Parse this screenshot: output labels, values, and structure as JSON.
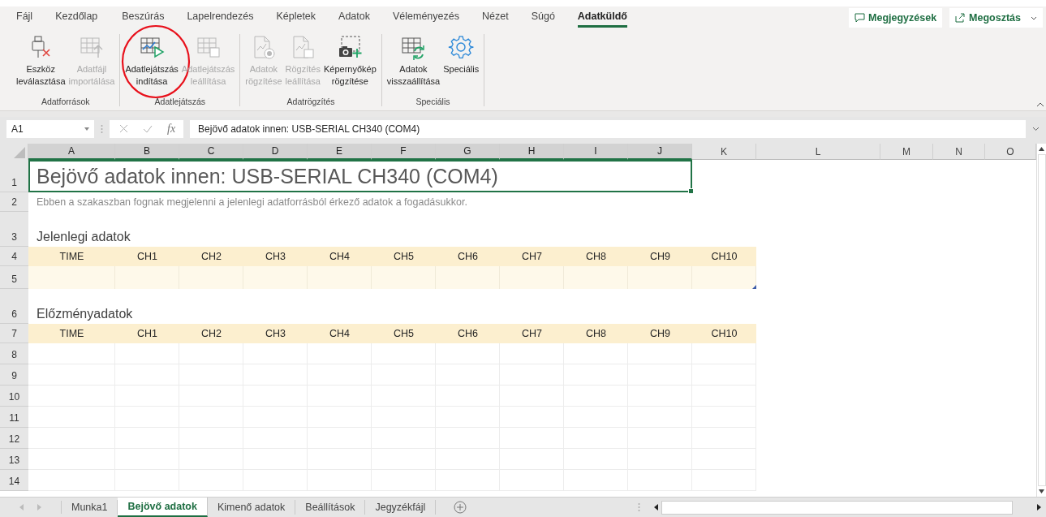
{
  "menu_tabs": [
    {
      "label": "Fájl",
      "selected": false
    },
    {
      "label": "Kezdőlap",
      "selected": false
    },
    {
      "label": "Beszúrás",
      "selected": false
    },
    {
      "label": "Lapelrendezés",
      "selected": false
    },
    {
      "label": "Képletek",
      "selected": false
    },
    {
      "label": "Adatok",
      "selected": false
    },
    {
      "label": "Véleményezés",
      "selected": false
    },
    {
      "label": "Nézet",
      "selected": false
    },
    {
      "label": "Súgó",
      "selected": false
    },
    {
      "label": "Adatküldő",
      "selected": true
    }
  ],
  "top_buttons": [
    {
      "label": "Megjegyzések"
    },
    {
      "label": "Megosztás"
    }
  ],
  "ribbon_groups": [
    {
      "label": "Adatforrások",
      "buttons": [
        {
          "lines": [
            "Eszköz",
            "leválasztása"
          ],
          "disabled": false,
          "circled": false
        },
        {
          "lines": [
            "Adatfájl",
            "importálása"
          ],
          "disabled": true,
          "circled": false
        }
      ]
    },
    {
      "label": "Adatlejátszás",
      "buttons": [
        {
          "lines": [
            "Adatlejátszás",
            "indítása"
          ],
          "disabled": false,
          "circled": true
        },
        {
          "lines": [
            "Adatlejátszás",
            "leállítása"
          ],
          "disabled": true,
          "circled": false
        }
      ]
    },
    {
      "label": "Adatrögzítés",
      "buttons": [
        {
          "lines": [
            "Adatok",
            "rögzítése"
          ],
          "disabled": true,
          "circled": false
        },
        {
          "lines": [
            "Rögzítés",
            "leállítása"
          ],
          "disabled": true,
          "circled": false
        },
        {
          "lines": [
            "Képernyőkép",
            "rögzítése"
          ],
          "disabled": false,
          "circled": false
        }
      ]
    },
    {
      "label": "Speciális",
      "buttons": [
        {
          "lines": [
            "Adatok",
            "visszaállítása"
          ],
          "disabled": false,
          "circled": false
        },
        {
          "lines": [
            "Speciális"
          ],
          "disabled": false,
          "circled": false
        }
      ]
    }
  ],
  "formula_bar": {
    "name_box": "A1",
    "fx_label": "fx",
    "formula": "Bejövő adatok innen: USB-SERIAL CH340 (COM4)"
  },
  "columns": [
    {
      "letter": "A",
      "selected": true
    },
    {
      "letter": "B",
      "selected": true
    },
    {
      "letter": "C",
      "selected": true
    },
    {
      "letter": "D",
      "selected": true
    },
    {
      "letter": "E",
      "selected": true
    },
    {
      "letter": "F",
      "selected": true
    },
    {
      "letter": "G",
      "selected": true
    },
    {
      "letter": "H",
      "selected": true
    },
    {
      "letter": "I",
      "selected": true
    },
    {
      "letter": "J",
      "selected": true
    },
    {
      "letter": "K",
      "selected": false
    },
    {
      "letter": "L",
      "selected": false
    },
    {
      "letter": "M",
      "selected": false
    },
    {
      "letter": "N",
      "selected": false
    },
    {
      "letter": "O",
      "selected": false
    }
  ],
  "rows": [
    {
      "number": "1",
      "kind": "title",
      "text": "Bejövő adatok innen: USB-SERIAL CH340 (COM4)"
    },
    {
      "number": "2",
      "kind": "note",
      "text": "Ebben a szakaszban fognak megjelenni a jelenlegi adatforrásból érkező adatok a fogadásukkor."
    },
    {
      "number": "3",
      "kind": "section",
      "text": "Jelenlegi adatok"
    },
    {
      "number": "4",
      "kind": "header",
      "cells": [
        "TIME",
        "CH1",
        "CH2",
        "CH3",
        "CH4",
        "CH5",
        "CH6",
        "CH7",
        "CH8",
        "CH9",
        "CH10"
      ]
    },
    {
      "number": "5",
      "kind": "data"
    },
    {
      "number": "6",
      "kind": "section",
      "text": "Előzményadatok"
    },
    {
      "number": "7",
      "kind": "header",
      "cells": [
        "TIME",
        "CH1",
        "CH2",
        "CH3",
        "CH4",
        "CH5",
        "CH6",
        "CH7",
        "CH8",
        "CH9",
        "CH10"
      ]
    },
    {
      "number": "8",
      "kind": "empty"
    },
    {
      "number": "9",
      "kind": "empty"
    },
    {
      "number": "10",
      "kind": "empty"
    },
    {
      "number": "11",
      "kind": "empty"
    },
    {
      "number": "12",
      "kind": "empty"
    },
    {
      "number": "13",
      "kind": "empty"
    },
    {
      "number": "14",
      "kind": "empty"
    }
  ],
  "sheet_tabs": [
    {
      "label": "Munka1",
      "selected": false
    },
    {
      "label": "Bejövő adatok",
      "selected": true
    },
    {
      "label": "Kimenő adatok",
      "selected": false
    },
    {
      "label": "Beállítások",
      "selected": false
    },
    {
      "label": "Jegyzékfájl",
      "selected": false
    }
  ]
}
